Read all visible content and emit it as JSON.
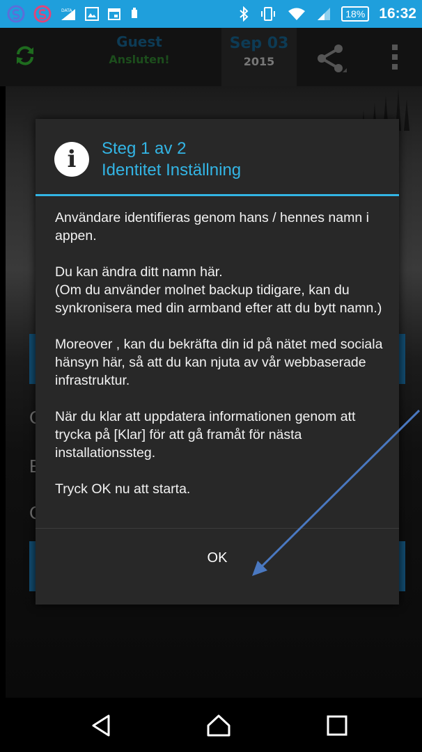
{
  "status_bar": {
    "battery": "18%",
    "time": "16:32",
    "background": "#1f9fdc",
    "icons": [
      "app-icon-s-outline",
      "app-icon-s-red",
      "data-signal-icon",
      "image-icon",
      "calendar-icon",
      "battery-plug-icon",
      "bluetooth-icon",
      "vibrate-icon",
      "wifi-icon",
      "cell-signal-icon"
    ]
  },
  "app_bar": {
    "user_name": "Guest",
    "connection_status": "Ansluten!",
    "date_month_day": "Sep 03",
    "date_year": "2015",
    "icons": [
      "refresh-icon",
      "share-icon",
      "overflow-menu-icon"
    ]
  },
  "background_letters": [
    "C",
    "E",
    "C"
  ],
  "dialog": {
    "title_line1": "Steg 1 av 2",
    "title_line2": "Identitet Inställning",
    "accent": "#33b5e5",
    "body": "Användare identifieras genom hans / hennes namn i appen.\n\nDu kan ändra ditt namn här.\n (Om du använder molnet backup tidigare, kan du synkronisera med din armband efter att du bytt namn.)\n\nMoreover , kan du bekräfta din id på nätet med sociala hänsyn här, så att du kan njuta av vår webbaserade infrastruktur.\n\nNär du klar att uppdatera informationen genom att trycka på [Klar] för att gå framåt för nästa installationssteg.\n\nTryck OK nu att starta.",
    "ok_label": "OK"
  },
  "nav_bar": {
    "icons": [
      "back-icon",
      "home-icon",
      "recents-icon"
    ]
  }
}
